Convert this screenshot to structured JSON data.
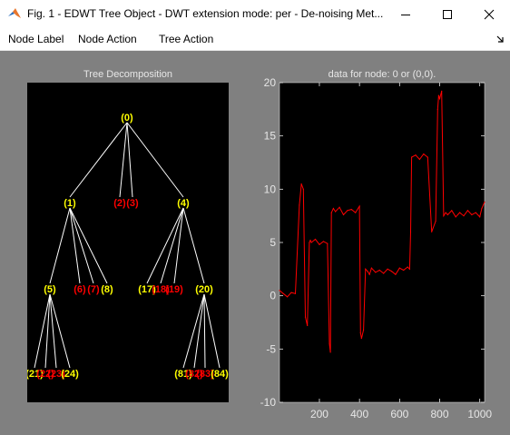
{
  "window": {
    "title": "Fig. 1 - EDWT Tree Object - DWT extension mode: per  -  De-noising Met...",
    "icon": "matlab-icon",
    "controls": [
      "minimize-icon",
      "maximize-icon",
      "close-icon"
    ]
  },
  "menu": {
    "items": [
      "Node Label",
      "Node Action",
      "Tree Action"
    ],
    "dock_icon": "dock-arrow-icon"
  },
  "colors": {
    "figure_bg": "#808080",
    "axes_bg": "#000000",
    "tick_text": "#e6e6e6",
    "node_yellow": "#ffff00",
    "node_red": "#ff0000",
    "signal": "#ff0000",
    "edge": "#ffffff"
  },
  "tree": {
    "title": "Tree Decomposition",
    "nodes": [
      {
        "label": "(0)",
        "color": "yellow"
      },
      {
        "label": "(1)",
        "color": "yellow"
      },
      {
        "label": "(2)",
        "color": "red"
      },
      {
        "label": "(3)",
        "color": "red"
      },
      {
        "label": "(4)",
        "color": "yellow"
      },
      {
        "label": "(5)",
        "color": "yellow"
      },
      {
        "label": "(6)",
        "color": "red"
      },
      {
        "label": "(7)",
        "color": "red"
      },
      {
        "label": "(8)",
        "color": "yellow"
      },
      {
        "label": "(17)",
        "color": "yellow"
      },
      {
        "label": "(18)",
        "color": "red"
      },
      {
        "label": "(19)",
        "color": "red"
      },
      {
        "label": "(20)",
        "color": "yellow"
      },
      {
        "label": "(21)",
        "color": "yellow"
      },
      {
        "label": "(22)",
        "color": "red"
      },
      {
        "label": "(23)",
        "color": "red"
      },
      {
        "label": "(24)",
        "color": "yellow"
      },
      {
        "label": "(81)",
        "color": "yellow"
      },
      {
        "label": "(82)",
        "color": "red"
      },
      {
        "label": "(83)",
        "color": "red"
      },
      {
        "label": "(84)",
        "color": "yellow"
      }
    ]
  },
  "chart_data": {
    "type": "line",
    "title": "data for node: 0 or (0,0).",
    "xlim": [
      1,
      1024
    ],
    "ylim": [
      -10,
      20
    ],
    "xticks": [
      200,
      400,
      600,
      800,
      1000
    ],
    "yticks": [
      -10,
      -5,
      0,
      5,
      10,
      15,
      20
    ],
    "grid": false,
    "series": [
      {
        "color": "#ff0000",
        "x": [
          1,
          20,
          40,
          60,
          80,
          100,
          110,
          120,
          130,
          140,
          150,
          155,
          160,
          180,
          200,
          220,
          240,
          250,
          255,
          260,
          270,
          280,
          300,
          320,
          340,
          360,
          380,
          400,
          405,
          410,
          420,
          430,
          440,
          450,
          460,
          480,
          500,
          520,
          540,
          560,
          580,
          600,
          620,
          640,
          650,
          655,
          660,
          680,
          700,
          720,
          740,
          760,
          780,
          790,
          795,
          800,
          810,
          820,
          830,
          840,
          860,
          880,
          900,
          920,
          940,
          960,
          980,
          1000,
          1010,
          1024
        ],
        "values": [
          0.5,
          0.2,
          -0.1,
          0.3,
          0.2,
          8.5,
          10.5,
          10.0,
          -2.0,
          -2.8,
          5.0,
          5.2,
          5.0,
          5.3,
          4.8,
          5.1,
          4.9,
          -4.5,
          -5.3,
          7.8,
          8.2,
          7.9,
          8.3,
          7.6,
          8.0,
          8.1,
          7.8,
          8.4,
          -3.5,
          -4.0,
          -3.2,
          2.5,
          2.3,
          2.0,
          2.6,
          2.2,
          2.4,
          2.1,
          2.5,
          2.3,
          2.0,
          2.6,
          2.4,
          2.7,
          2.5,
          6.0,
          13.0,
          13.2,
          12.8,
          13.3,
          13.0,
          6.0,
          7.0,
          17.5,
          18.8,
          18.5,
          19.2,
          7.5,
          7.8,
          7.6,
          8.0,
          7.4,
          7.8,
          7.5,
          8.0,
          7.6,
          7.8,
          7.4,
          8.2,
          8.8
        ]
      }
    ]
  }
}
